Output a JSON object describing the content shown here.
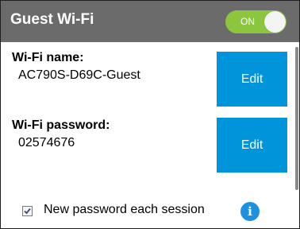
{
  "header": {
    "title": "Guest Wi-Fi",
    "toggle_label": "ON"
  },
  "wifi_name": {
    "label": "Wi-Fi name:",
    "value": "AC790S-D69C-Guest",
    "edit_label": "Edit"
  },
  "wifi_password": {
    "label": "Wi-Fi password:",
    "value": "02574676",
    "edit_label": "Edit"
  },
  "new_password_option": {
    "label": "New password each session",
    "checked": true,
    "info_icon": "i"
  },
  "colors": {
    "header_bg": "#6b6b6b",
    "toggle_on": "#8cc63f",
    "button_bg": "#0095da",
    "info_icon": "#1e90e0"
  }
}
